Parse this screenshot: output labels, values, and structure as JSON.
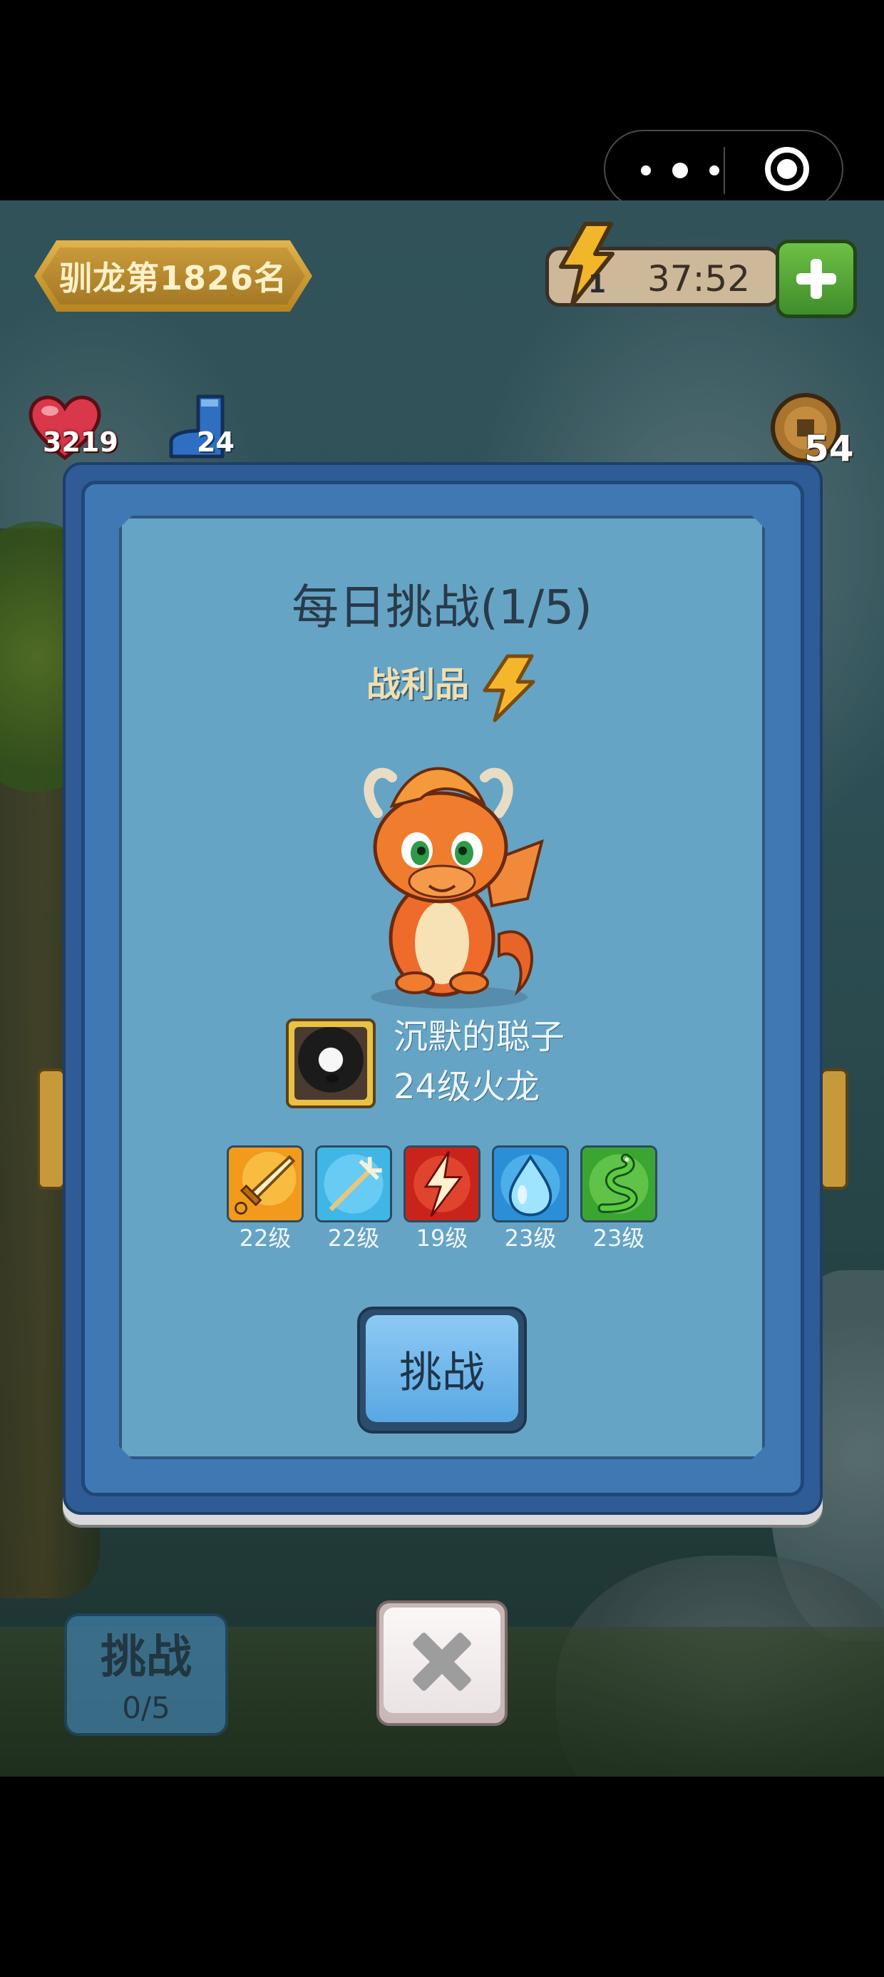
{
  "hud": {
    "rank_label": "驯龙第1826名",
    "energy_count": "1",
    "energy_timer": "37:52",
    "hearts": "3219",
    "boots": "24",
    "coins": "54"
  },
  "modal": {
    "title": "每日挑战(1/5)",
    "loot_label": "战利品",
    "opponent": {
      "name": "沉默的聪子",
      "level": "24级火龙"
    },
    "skills": [
      {
        "icon": "golden-sword-icon",
        "level": "22级",
        "color": "#f29a1c"
      },
      {
        "icon": "trident-icon",
        "level": "22级",
        "color": "#3fb6e6"
      },
      {
        "icon": "lightning-strike-icon",
        "level": "19级",
        "color": "#c8241c"
      },
      {
        "icon": "water-drop-icon",
        "level": "23级",
        "color": "#2b8fd8"
      },
      {
        "icon": "snake-icon",
        "level": "23级",
        "color": "#3aa530"
      }
    ],
    "challenge_label": "挑战"
  },
  "bottom": {
    "challenge_label": "挑战",
    "challenge_count": "0/5"
  },
  "colors": {
    "modal_frame": "#2f5c96",
    "modal_panel": "#65a4c5",
    "challenge_button": "#59a7e3",
    "energy_plus": "#4fa636"
  }
}
